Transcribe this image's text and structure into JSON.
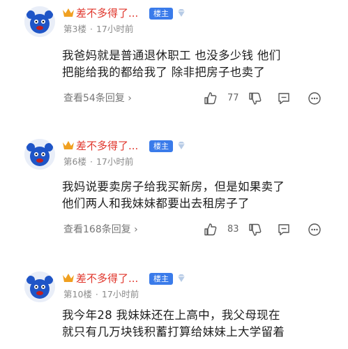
{
  "posts": [
    {
      "username": "差不多得了...",
      "badge": "楼主",
      "floor": "第3楼",
      "time": "17小时前",
      "lines": [
        "我爸妈就是普通退休职工 也没多少钱 他们",
        "把能给我的都给我了 除非把房子也卖了"
      ],
      "replies": "查看54条回复",
      "likes": "77"
    },
    {
      "username": "差不多得了...",
      "badge": "楼主",
      "floor": "第6楼",
      "time": "17小时前",
      "lines": [
        "我妈说要卖房子给我买新房，但是如果卖了",
        "他们两人和我妹妹都要出去租房子了"
      ],
      "replies": "查看168条回复",
      "likes": "83"
    },
    {
      "username": "差不多得了...",
      "badge": "楼主",
      "floor": "第10楼",
      "time": "17小时前",
      "lines": [
        "我今年28 我妹妹还在上高中，我父母现在",
        "就只有几万块钱积蓄打算给妹妹上大学留着"
      ],
      "replies": "",
      "likes": ""
    }
  ],
  "colors": {
    "username": "#e0352b",
    "badge_bg": "#3a7bea",
    "meta": "#8a8a8a"
  },
  "icons": [
    "crown-icon",
    "diamond-icon",
    "thumbs-up-icon",
    "thumbs-down-icon",
    "comment-icon",
    "more-icon"
  ]
}
